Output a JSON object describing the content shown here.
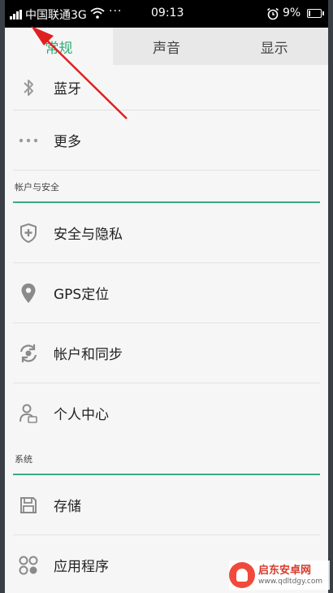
{
  "status_bar": {
    "carrier": "中国联通3G",
    "overflow": "···",
    "time": "09:13",
    "battery_percent": "9%",
    "battery_level": 0.09,
    "icons": [
      "signal-icon",
      "wifi-icon",
      "alarm-icon",
      "battery-icon"
    ]
  },
  "tabs": [
    {
      "label": "常规",
      "active": true
    },
    {
      "label": "声音",
      "active": false
    },
    {
      "label": "显示",
      "active": false
    }
  ],
  "items_top": [
    {
      "label": "蓝牙",
      "icon": "bluetooth-icon"
    },
    {
      "label": "更多",
      "icon": "more-dots-icon"
    }
  ],
  "section_account": "帐户与安全",
  "items_account": [
    {
      "label": "安全与隐私",
      "icon": "shield-icon"
    },
    {
      "label": "GPS定位",
      "icon": "location-pin-icon"
    },
    {
      "label": "帐户和同步",
      "icon": "sync-icon"
    },
    {
      "label": "个人中心",
      "icon": "user-icon"
    }
  ],
  "section_system": "系统",
  "items_system": [
    {
      "label": "存储",
      "icon": "storage-icon"
    },
    {
      "label": "应用程序",
      "icon": "apps-icon"
    }
  ],
  "watermark": {
    "title": "启东安卓网",
    "url": "www.qdltdgy.com"
  },
  "colors": {
    "accent": "#2eaa77",
    "annotation_arrow": "#e02020"
  }
}
